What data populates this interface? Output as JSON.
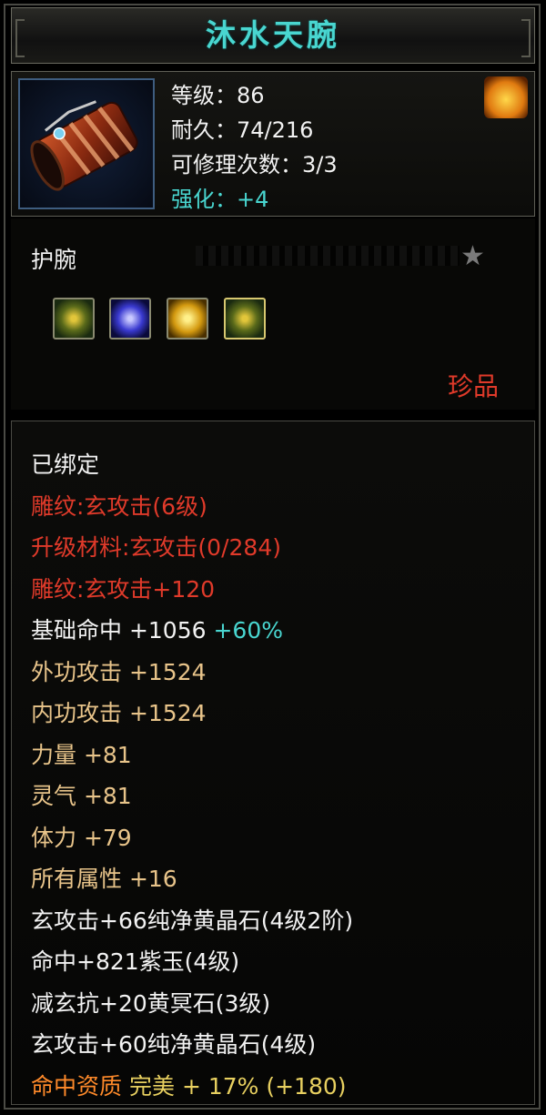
{
  "item": {
    "name": "沐水天腕",
    "type": "护腕",
    "quality": "珍品"
  },
  "stats": {
    "level": "等级：86",
    "durability": "耐久：74/216",
    "repairs": "可修理次数：3/3",
    "enhance": "强化：+4"
  },
  "gems": [
    "yellow-green-gem-icon",
    "purple-gem-icon",
    "gold-gem-icon",
    "yellow-green-gem-icon"
  ],
  "attributes": {
    "bound": "已绑定",
    "engrave_level": "雕纹:玄攻击(6级)",
    "upgrade_material": "升级材料:玄攻击(0/284)",
    "engrave_bonus": "雕纹:玄攻击+120",
    "hit_label": "基础命中  +1056",
    "hit_pct": " +60%",
    "ext_attack": "外功攻击  +1524",
    "int_attack": "内功攻击  +1524",
    "strength": "力量  +81",
    "spirit": "灵气  +81",
    "stamina": "体力  +79",
    "all_attr": "所有属性  +16",
    "socket1": "玄攻击+66纯净黄晶石(4级2阶)",
    "socket2": "命中+821紫玉(4级)",
    "socket3": "减玄抗+20黄冥石(3级)",
    "socket4": "玄攻击+60纯净黄晶石(4级)",
    "aptitude_label": "命中资质",
    "aptitude_grade": "完美",
    "aptitude_value": "+ 17% (+180)"
  },
  "colors": {
    "title": "#49d6d0",
    "rare": "#e03a2a",
    "attr": "#e8c48a",
    "aptitude": "#ff8a2a"
  }
}
